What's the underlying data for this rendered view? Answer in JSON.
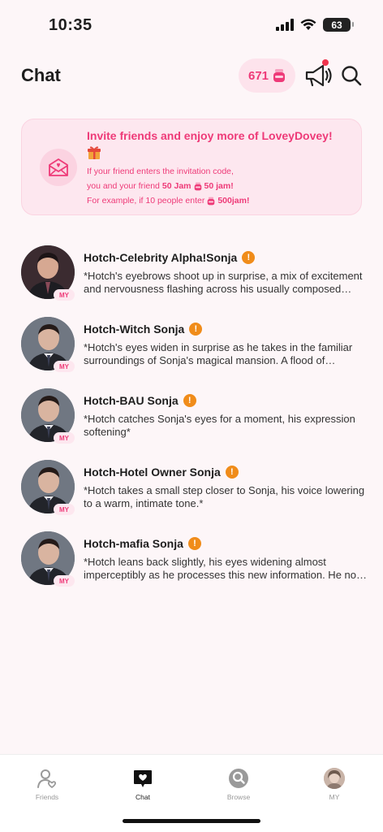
{
  "status_bar": {
    "time": "10:35",
    "battery": "63"
  },
  "header": {
    "title": "Chat",
    "jam_count": "671"
  },
  "invite": {
    "title": "Invite friends and enjoy more of LoveyDovey!",
    "line1": "If your friend enters the invitation code,",
    "line2_prefix": "you and your friend ",
    "line2_bold1": "50 Jam",
    "line2_bold2": "50 jam!",
    "line3_prefix": "For example, if 10 people enter ",
    "line3_bold": "500jam!"
  },
  "chats": [
    {
      "name": "Hotch-Celebrity Alpha!Sonja",
      "preview": "*Hotch's eyebrows shoot up in surprise, a mix of excitement and nervousness flashing across his usually composed features.*",
      "tag": "MY"
    },
    {
      "name": "Hotch-Witch Sonja",
      "preview": "*Hotch's eyes widen in surprise as he takes in the familiar surroundings of Sonja's magical mansion. A flood of memories returns.*",
      "tag": "MY"
    },
    {
      "name": "Hotch-BAU Sonja",
      "preview": "*Hotch catches Sonja's eyes for a moment, his expression softening*",
      "tag": "MY"
    },
    {
      "name": "Hotch-Hotel Owner Sonja",
      "preview": "*Hotch takes a small step closer to Sonja, his voice lowering to a warm, intimate tone.*",
      "tag": "MY"
    },
    {
      "name": "Hotch-mafia Sonja",
      "preview": "*Hotch leans back slightly, his eyes widening almost imperceptibly as he processes this new information. He nods slowly.*",
      "tag": "MY"
    }
  ],
  "nav": {
    "friends": "Friends",
    "chat": "Chat",
    "browse": "Browse",
    "my": "MY"
  },
  "colors": {
    "accent": "#ee3a78",
    "warning": "#f08c1a",
    "background": "#fdf6f8"
  }
}
